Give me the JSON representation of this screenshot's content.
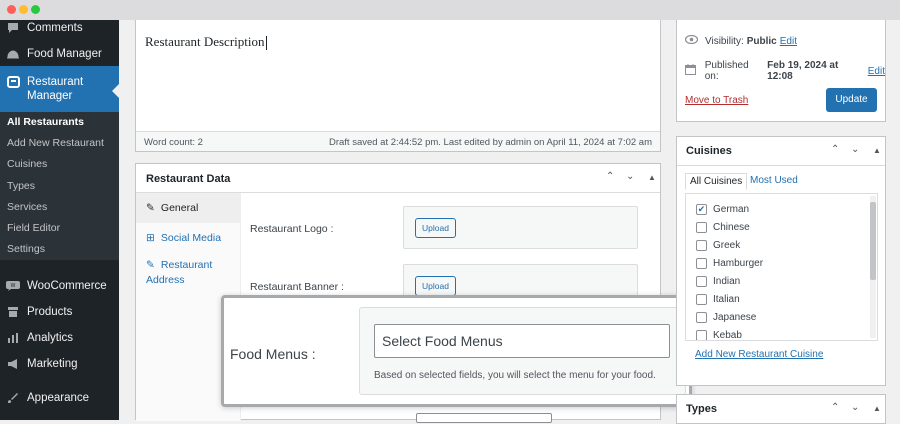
{
  "window": {
    "controls": [
      "close",
      "minimize",
      "maximize"
    ],
    "colors": [
      "#ff5f57",
      "#febc2e",
      "#28c840"
    ]
  },
  "sidebar": {
    "items": [
      {
        "label": "Comments",
        "icon": "comment-icon"
      },
      {
        "label": "Food Manager",
        "icon": "food-manager-icon"
      },
      {
        "label": "Restaurant Manager",
        "icon": "restaurant-manager-icon",
        "active": true
      },
      {
        "label": "WooCommerce",
        "icon": "woocommerce-icon"
      },
      {
        "label": "Products",
        "icon": "products-icon"
      },
      {
        "label": "Analytics",
        "icon": "analytics-icon"
      },
      {
        "label": "Marketing",
        "icon": "marketing-icon"
      },
      {
        "label": "Appearance",
        "icon": "appearance-icon"
      }
    ],
    "submenu": [
      "All Restaurants",
      "Add New Restaurant",
      "Cuisines",
      "Types",
      "Services",
      "Field Editor",
      "Settings"
    ],
    "current_submenu": "All Restaurants",
    "accent": "#2271b1"
  },
  "editor": {
    "content": "Restaurant Description",
    "word_count": "Word count: 2",
    "draft_status": "Draft saved at 2:44:52 pm. Last edited by admin on April 11, 2024 at 7:02 am"
  },
  "restaurant_data": {
    "title": "Restaurant Data",
    "tabs": [
      {
        "label": "General",
        "icon": "wrench-icon",
        "active": true
      },
      {
        "label": "Social Media",
        "icon": "grid-icon"
      },
      {
        "label": "Restaurant Address",
        "icon": "wrench-icon"
      }
    ],
    "fields": {
      "logo_label": "Restaurant Logo :",
      "banner_label": "Restaurant Banner :",
      "upload_label": "Upload"
    }
  },
  "callout": {
    "label": "Food Menus :",
    "placeholder": "Select Food Menus",
    "help": "Based on selected fields, you will select the menu for your food."
  },
  "publish": {
    "visibility_label": "Visibility:",
    "visibility_value": "Public",
    "published_label": "Published on:",
    "published_value": "Feb 19, 2024 at 12:08",
    "edit_link": "Edit",
    "trash_link": "Move to Trash",
    "update_button": "Update"
  },
  "cuisines": {
    "title": "Cuisines",
    "tab_all": "All Cuisines",
    "tab_most_used": "Most Used",
    "items": [
      {
        "label": "German",
        "checked": true
      },
      {
        "label": "Chinese",
        "checked": false
      },
      {
        "label": "Greek",
        "checked": false
      },
      {
        "label": "Hamburger",
        "checked": false
      },
      {
        "label": "Indian",
        "checked": false
      },
      {
        "label": "Italian",
        "checked": false
      },
      {
        "label": "Japanese",
        "checked": false
      },
      {
        "label": "Kebab",
        "checked": false
      }
    ],
    "add_new": "Add New Restaurant Cuisine"
  },
  "types": {
    "title": "Types"
  }
}
